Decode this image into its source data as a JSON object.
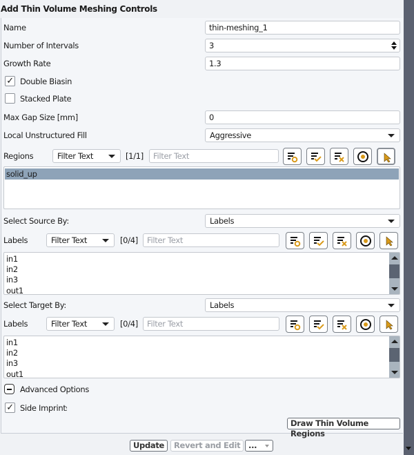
{
  "title": "Add Thin Volume Meshing Controls",
  "name": {
    "label": "Name",
    "value": "thin-meshing_1"
  },
  "intervals": {
    "label": "Number of Intervals",
    "value": "3"
  },
  "growth": {
    "label": "Growth Rate",
    "value": "1.3"
  },
  "double_biasing": {
    "label": "Double Biasing",
    "checked": true
  },
  "stacked_plates": {
    "label": "Stacked Plates",
    "checked": false
  },
  "max_gap": {
    "label": "Max Gap Size [mm]",
    "value": "0"
  },
  "fill": {
    "label": "Local Unstructured Fill",
    "value": "Aggressive"
  },
  "regions": {
    "label": "Regions",
    "filter_mode": "Filter Text",
    "count": "[1/1]",
    "filter_placeholder": "Filter Text",
    "items": [
      "solid_up"
    ],
    "selected": "solid_up"
  },
  "source": {
    "label": "Select Source By:",
    "value": "Labels",
    "list_label": "Labels",
    "filter_mode": "Filter Text",
    "count": "[0/4]",
    "filter_placeholder": "Filter Text",
    "items": [
      "in1",
      "in2",
      "in3",
      "out1"
    ]
  },
  "target": {
    "label": "Select Target By:",
    "value": "Labels",
    "list_label": "Labels",
    "filter_mode": "Filter Text",
    "count": "[0/4]",
    "filter_placeholder": "Filter Text",
    "items": [
      "in1",
      "in2",
      "in3",
      "out1"
    ]
  },
  "advanced": {
    "label": "Advanced Options",
    "expanded": true
  },
  "side_imprints": {
    "label": "Side Imprints",
    "checked": true
  },
  "draw_button": "Draw Thin Volume Regions",
  "footer": {
    "update": "Update",
    "revert": "Revert and Edit",
    "more": "..."
  },
  "icons": [
    "filter-options-icon",
    "select-all-icon",
    "deselect-all-icon",
    "use-filter-icon",
    "pick-icon"
  ],
  "colors": {
    "accent": "#d99a1a",
    "selected_row": "#8ea3b8",
    "scrollbar": "#5b6170"
  }
}
